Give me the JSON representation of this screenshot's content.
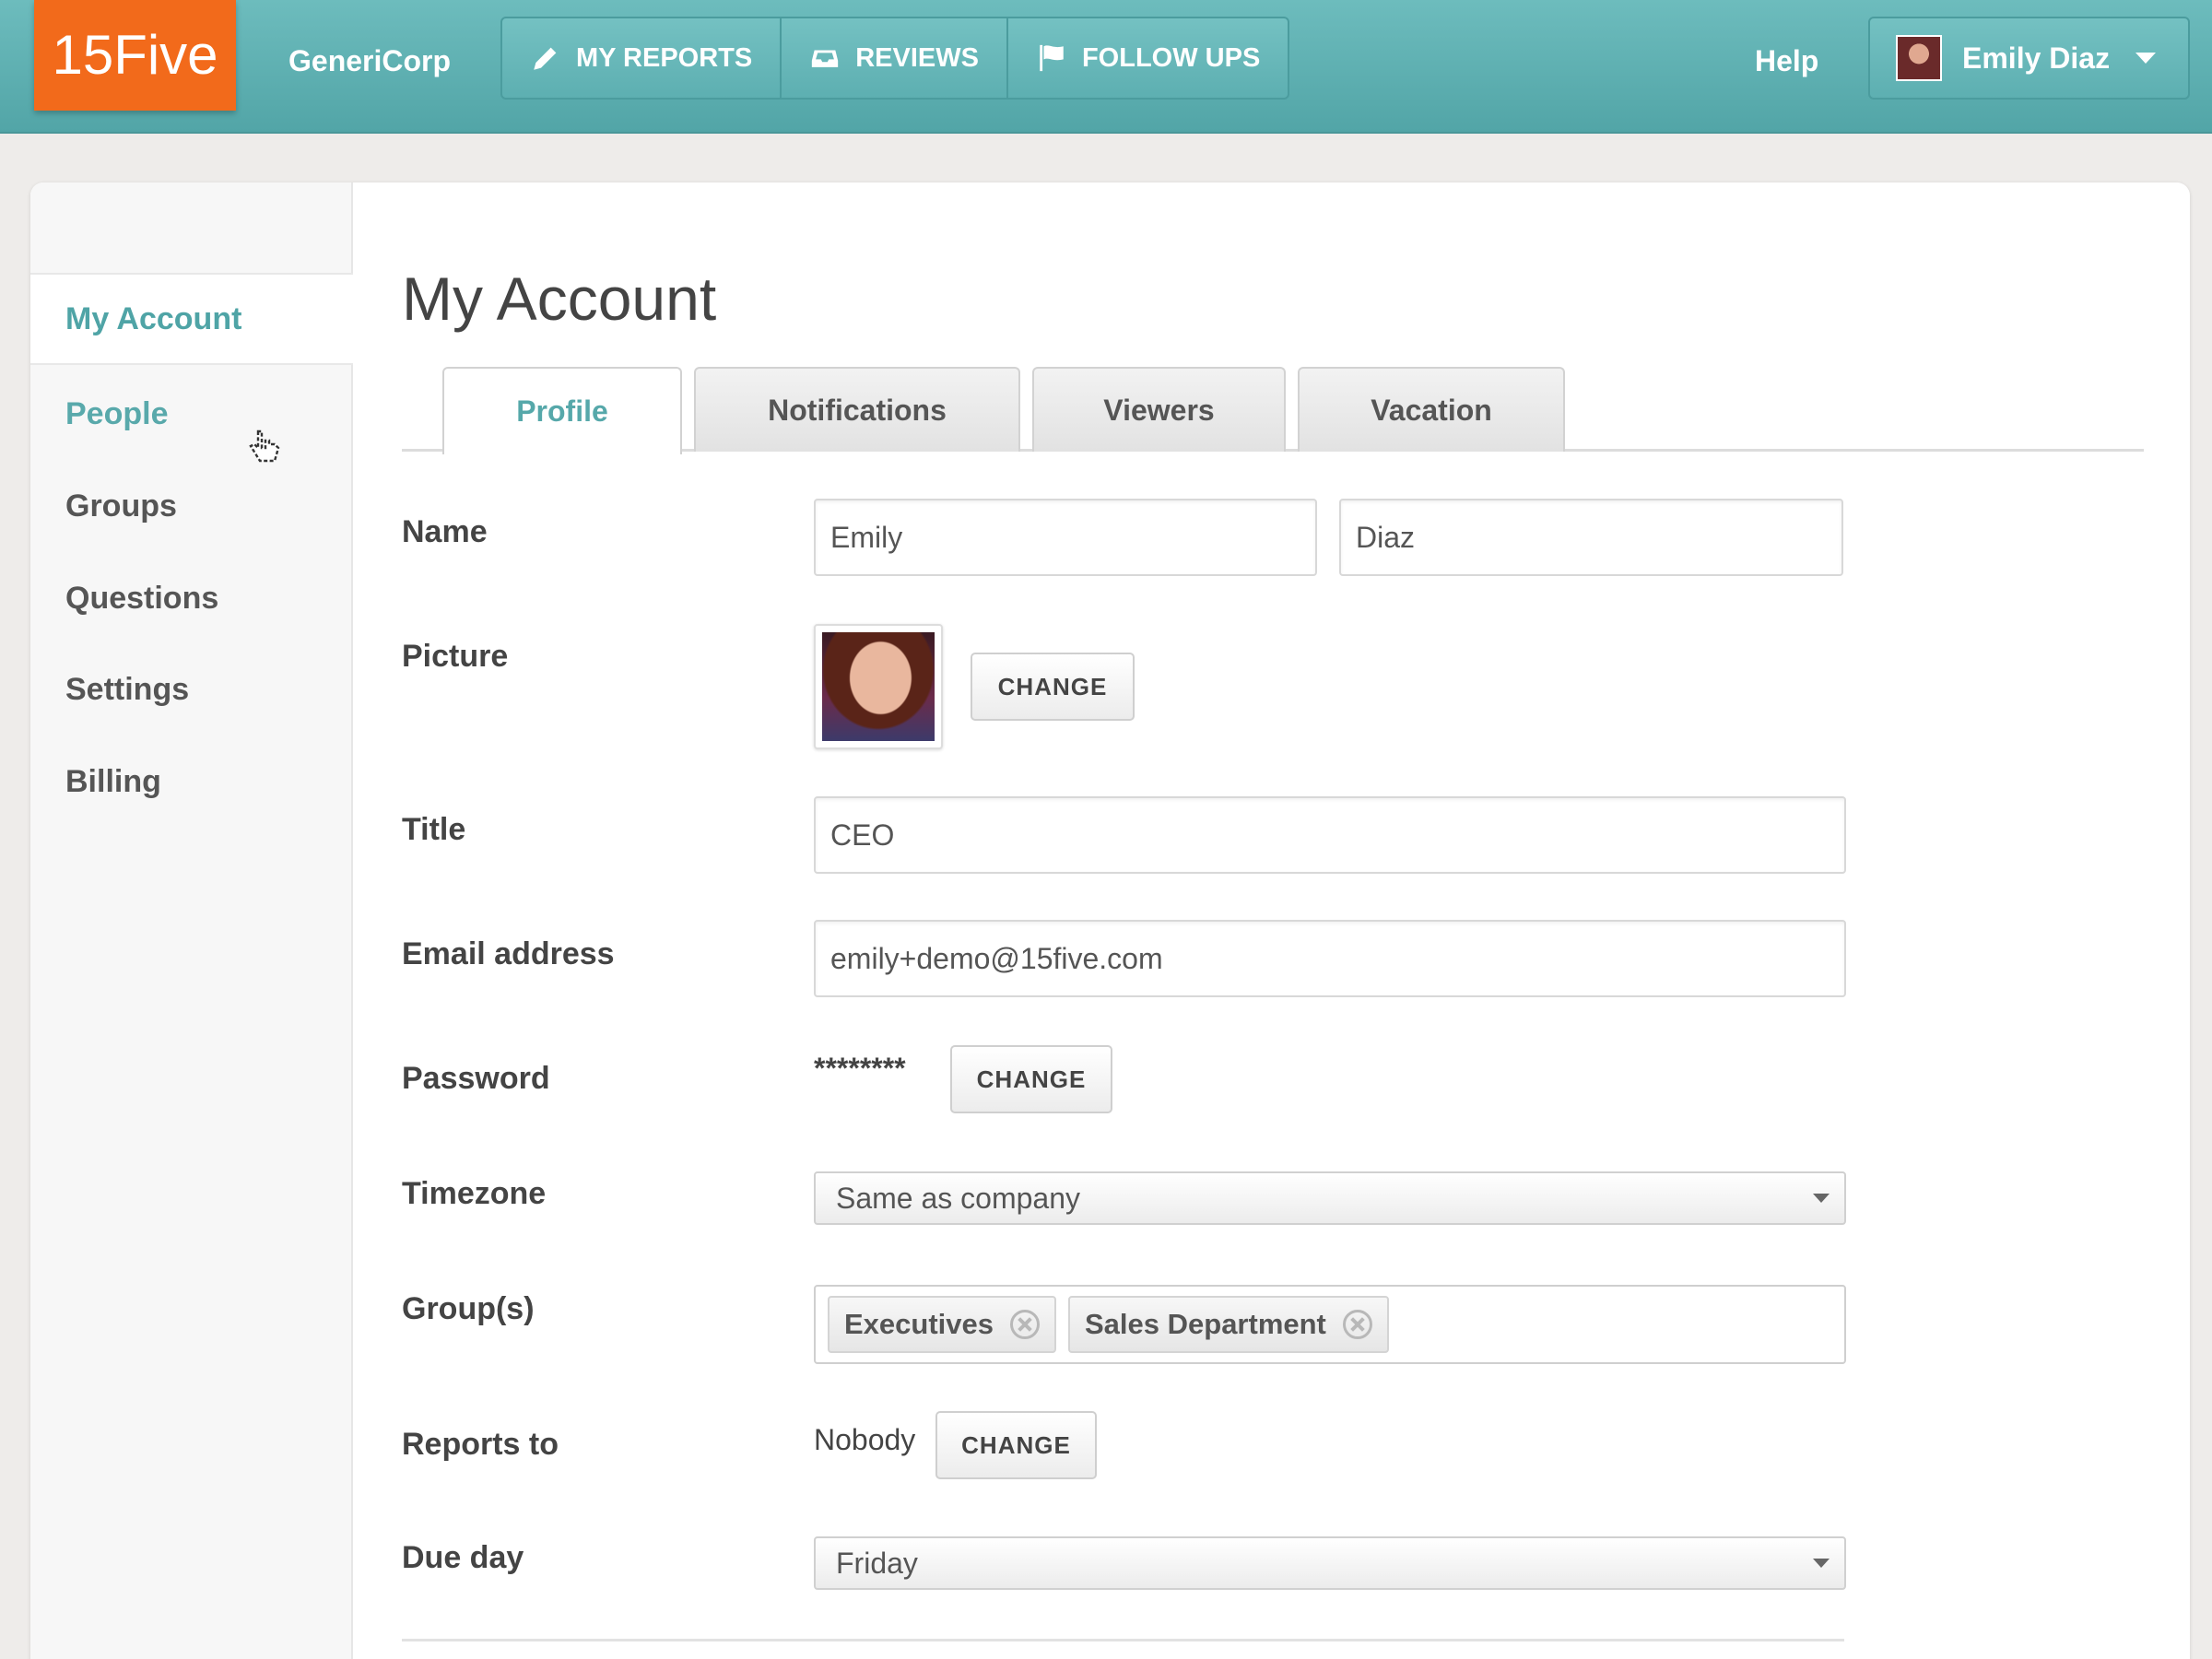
{
  "topnav": {
    "logo": "15Five",
    "company": "GeneriCorp",
    "nav": [
      {
        "label": "MY REPORTS",
        "icon": "pencil-icon"
      },
      {
        "label": "REVIEWS",
        "icon": "inbox-icon"
      },
      {
        "label": "FOLLOW UPS",
        "icon": "flag-icon"
      }
    ],
    "help": "Help",
    "user_name": "Emily Diaz"
  },
  "sidebar": {
    "items": [
      {
        "label": "My Account",
        "state": "active"
      },
      {
        "label": "People",
        "state": "link"
      },
      {
        "label": "Groups"
      },
      {
        "label": "Questions"
      },
      {
        "label": "Settings"
      },
      {
        "label": "Billing"
      }
    ]
  },
  "main": {
    "title": "My Account",
    "tabs": [
      {
        "label": "Profile",
        "active": true
      },
      {
        "label": "Notifications"
      },
      {
        "label": "Viewers"
      },
      {
        "label": "Vacation"
      }
    ],
    "form": {
      "name_label": "Name",
      "first_name": "Emily",
      "last_name": "Diaz",
      "picture_label": "Picture",
      "picture_change": "CHANGE",
      "title_label": "Title",
      "title_value": "CEO",
      "email_label": "Email address",
      "email_value": "emily+demo@15five.com",
      "password_label": "Password",
      "password_mask": "********",
      "password_change": "CHANGE",
      "timezone_label": "Timezone",
      "timezone_value": "Same as company",
      "groups_label": "Group(s)",
      "groups": [
        "Executives",
        "Sales Department"
      ],
      "reports_label": "Reports to",
      "reports_value": "Nobody",
      "reports_change": "CHANGE",
      "dueday_label": "Due day",
      "dueday_value": "Friday"
    }
  },
  "colors": {
    "topbar": "#5fb0b2",
    "logo": "#f26a1b",
    "accent_text": "#4fa4a6"
  }
}
